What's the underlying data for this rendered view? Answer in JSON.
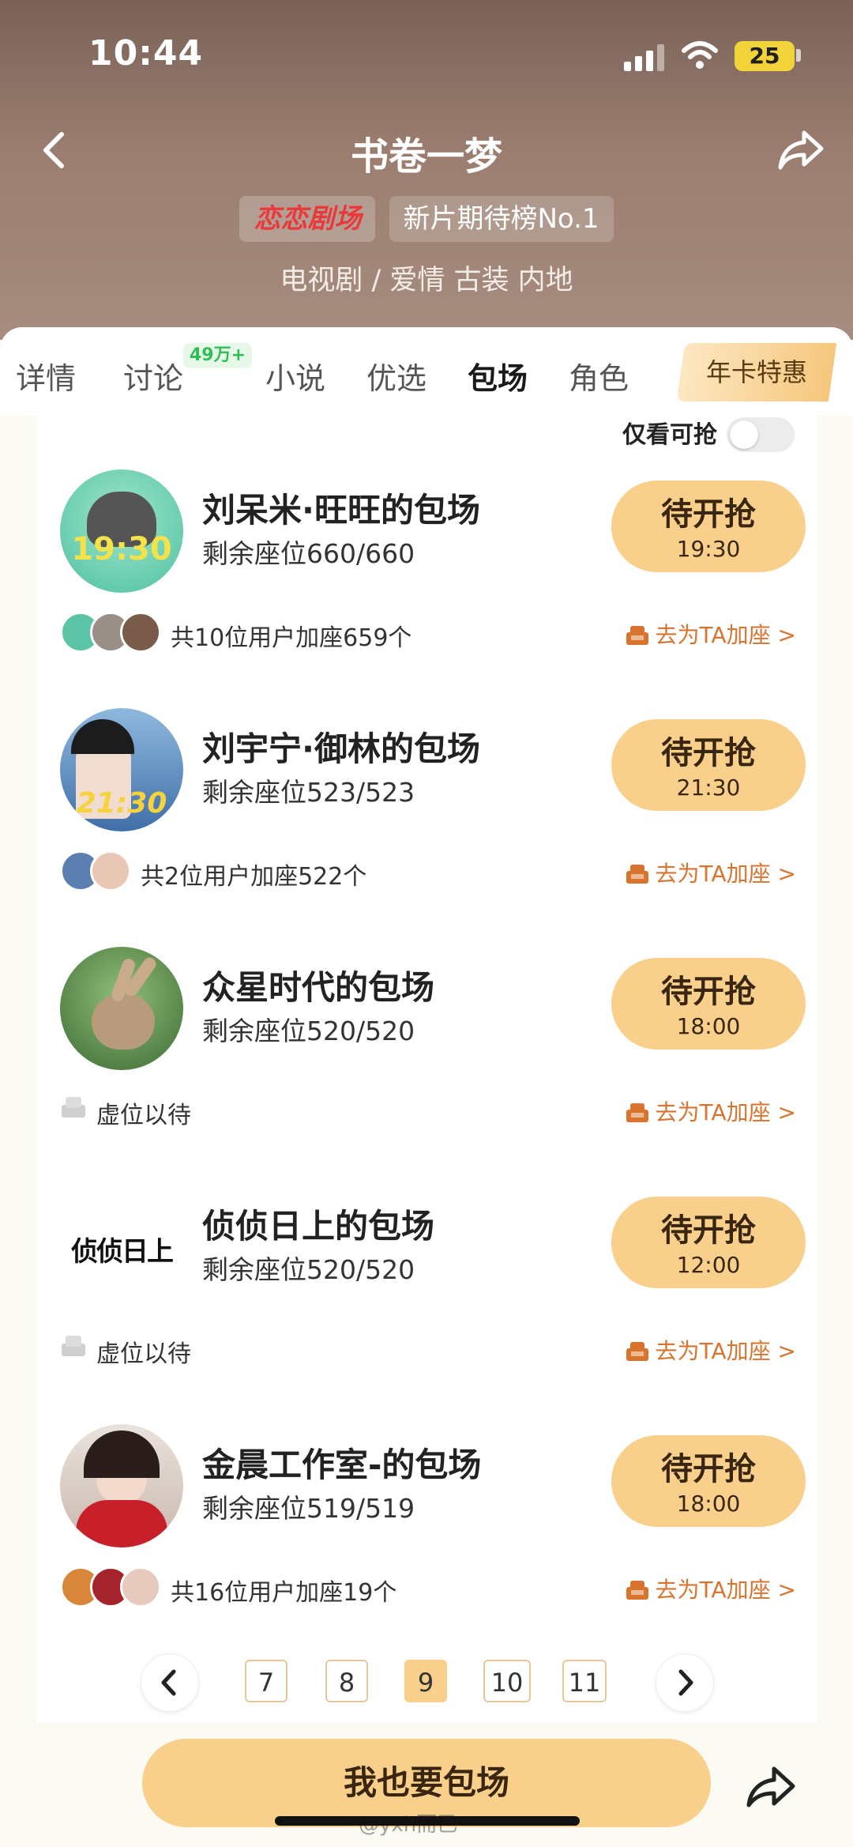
{
  "status": {
    "time": "10:44",
    "battery": "25"
  },
  "nav": {
    "title": "书卷一梦"
  },
  "tags": {
    "brand": "恋恋剧场",
    "rank": "新片期待榜No.1"
  },
  "genre": "电视剧 / 爱情 古装 内地",
  "tabs": [
    {
      "label": "详情"
    },
    {
      "label": "讨论",
      "badge": "49万+"
    },
    {
      "label": "小说"
    },
    {
      "label": "优选"
    },
    {
      "label": "包场"
    },
    {
      "label": "角色"
    }
  ],
  "annual_card": "年卡特惠",
  "filter": {
    "label": "仅看可抢",
    "on": false
  },
  "booking_action": "去为TA加座 >",
  "bookings": [
    {
      "name": "刘呆米·旺旺的包场",
      "seats": "剩余座位660/660",
      "status": "待开抢",
      "time": "19:30",
      "avatar_text": "19:30",
      "joiners": "共10位用户加座659个",
      "mini_count": 3
    },
    {
      "name": "刘宇宁·御林的包场",
      "seats": "剩余座位523/523",
      "status": "待开抢",
      "time": "21:30",
      "avatar_text": "21:30",
      "joiners": "共2位用户加座522个",
      "mini_count": 2
    },
    {
      "name": "众星时代的包场",
      "seats": "剩余座位520/520",
      "status": "待开抢",
      "time": "18:00",
      "avatar_text": "",
      "joiners": "虚位以待",
      "mini_count": 0
    },
    {
      "name": "侦侦日上的包场",
      "seats": "剩余座位520/520",
      "status": "待开抢",
      "time": "12:00",
      "avatar_text": "侦侦日上",
      "joiners": "虚位以待",
      "mini_count": 0
    },
    {
      "name": "金晨工作室-的包场",
      "seats": "剩余座位519/519",
      "status": "待开抢",
      "time": "18:00",
      "avatar_text": "",
      "joiners": "共16位用户加座19个",
      "mini_count": 3
    }
  ],
  "pagination": {
    "pages": [
      "7",
      "8",
      "9",
      "10",
      "11"
    ],
    "current": "9"
  },
  "cta": "我也要包场",
  "watermark": "@yxh而已",
  "colors": {
    "accent": "#f8d08b",
    "action": "#d8742f",
    "badge": "#2fbe55",
    "brand": "#e8393b"
  }
}
